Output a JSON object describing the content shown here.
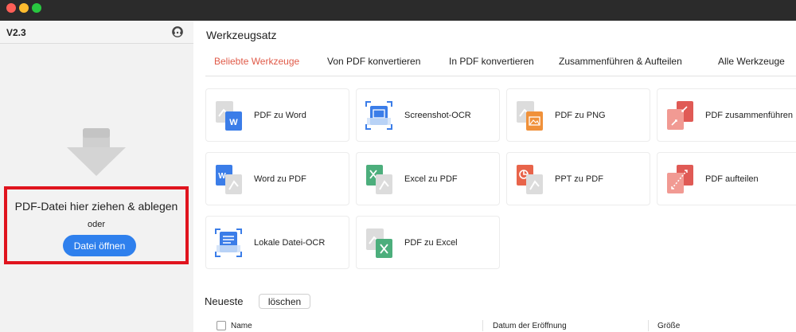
{
  "window": {
    "traffic_lights": [
      "#fe5f57",
      "#febc2e",
      "#28c840"
    ]
  },
  "sidebar": {
    "version": "V2.3",
    "support_icon": "headset-icon",
    "drop_title": "PDF-Datei hier ziehen & ablegen",
    "drop_or": "oder",
    "open_button": "Datei öffnen",
    "drop_icon": "download-arrow-icon"
  },
  "main": {
    "title": "Werkzeugsatz",
    "tabs": [
      {
        "label": "Beliebte Werkzeuge",
        "active": true
      },
      {
        "label": "Von PDF konvertieren",
        "active": false
      },
      {
        "label": "In PDF konvertieren",
        "active": false
      },
      {
        "label": "Zusammenführen & Aufteilen",
        "active": false
      },
      {
        "label": "Alle Werkzeuge",
        "active": false
      }
    ],
    "tools": [
      {
        "label": "PDF zu Word",
        "icon": "pdf-to-word-icon"
      },
      {
        "label": "Screenshot-OCR",
        "icon": "screenshot-ocr-icon"
      },
      {
        "label": "PDF zu PNG",
        "icon": "pdf-to-png-icon"
      },
      {
        "label": "PDF zusammenführen",
        "icon": "pdf-merge-icon"
      },
      {
        "label": "Word zu PDF",
        "icon": "word-to-pdf-icon"
      },
      {
        "label": "Excel zu PDF",
        "icon": "excel-to-pdf-icon"
      },
      {
        "label": "PPT zu PDF",
        "icon": "ppt-to-pdf-icon"
      },
      {
        "label": "PDF aufteilen",
        "icon": "pdf-split-icon"
      },
      {
        "label": "Lokale Datei-OCR",
        "icon": "local-file-ocr-icon"
      },
      {
        "label": "PDF zu Excel",
        "icon": "pdf-to-excel-icon"
      }
    ],
    "recent": {
      "title": "Neueste",
      "clear_button": "löschen",
      "columns": [
        "Name",
        "Datum der Eröffnung",
        "Größe"
      ]
    }
  },
  "colors": {
    "accent_blue": "#2f80ed",
    "active_tab": "#e05a48",
    "word_blue": "#3b7de8",
    "excel_green": "#4cae7c",
    "ppt_orange": "#e8644a",
    "png_orange": "#f0913a",
    "merge_red": "#e05a55",
    "highlight_red": "#e0141e"
  }
}
